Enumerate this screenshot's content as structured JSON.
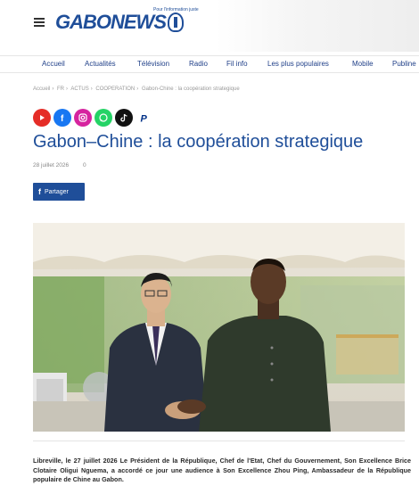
{
  "header": {
    "logo_text": "GABONEWS",
    "logo_tagline": "Pour l'information juste",
    "menu_icon": "hamburger-menu-icon"
  },
  "nav": {
    "items": [
      "Accueil",
      "Actualités",
      "Télévision",
      "Radio",
      "Fil info",
      "Les plus populaires",
      "Mobile",
      "Publine"
    ]
  },
  "breadcrumb": {
    "items": [
      "Accueil",
      "FR",
      "ACTUS",
      "COOPERATION",
      "Gabon-Chine : la coopération strategique"
    ]
  },
  "socials": [
    {
      "name": "youtube-icon",
      "color": "#e52d27"
    },
    {
      "name": "facebook-icon",
      "color": "#1877f2"
    },
    {
      "name": "instagram-icon",
      "color": "#d6249f"
    },
    {
      "name": "whatsapp-icon",
      "color": "#25d366"
    },
    {
      "name": "tiktok-icon",
      "color": "#111111"
    },
    {
      "name": "paypal-icon",
      "color": "#003087"
    }
  ],
  "article": {
    "title": "Gabon–Chine : la coopération strategique",
    "date": "28 juillet 2026",
    "comments": "0",
    "share_label": "Partager",
    "body": "Libreville, le 27 juillet 2026 Le Président de la République, Chef de l'Etat, Chef du Gouvernement, Son Excellence Brice Clotaire Oligui Nguema, a accordé ce jour une audience à Son Excellence Zhou Ping, Ambassadeur de la République populaire de Chine au Gabon."
  },
  "colors": {
    "brand": "#1f4e99",
    "nav_text": "#1f3f88",
    "muted": "#888888"
  }
}
